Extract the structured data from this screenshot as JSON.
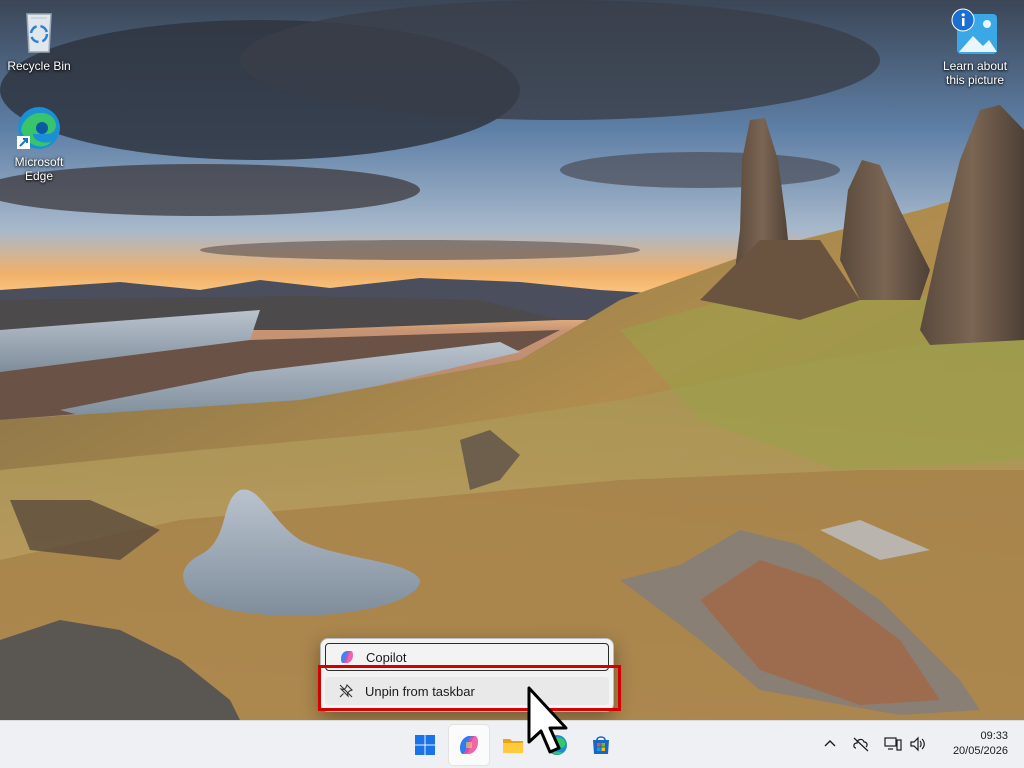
{
  "desktop": {
    "icons": [
      {
        "label": "Recycle Bin"
      },
      {
        "label": "Microsoft Edge"
      },
      {
        "label": "Learn about this picture"
      }
    ]
  },
  "jumplist": {
    "app_label": "Copilot",
    "unpin_label": "Unpin from taskbar"
  },
  "taskbar": {
    "apps": [
      "Start",
      "Copilot",
      "File Explorer",
      "Microsoft Edge",
      "Microsoft Store"
    ],
    "tray_icons": [
      "chevron-up-icon",
      "no-internet-icon",
      "network-icon",
      "volume-icon"
    ],
    "time": "09:33",
    "date": "20/05/2026"
  },
  "colors": {
    "highlight": "#d40000",
    "taskbar_bg": "#eef0f3",
    "menu_bg": "#f3f3f3"
  }
}
